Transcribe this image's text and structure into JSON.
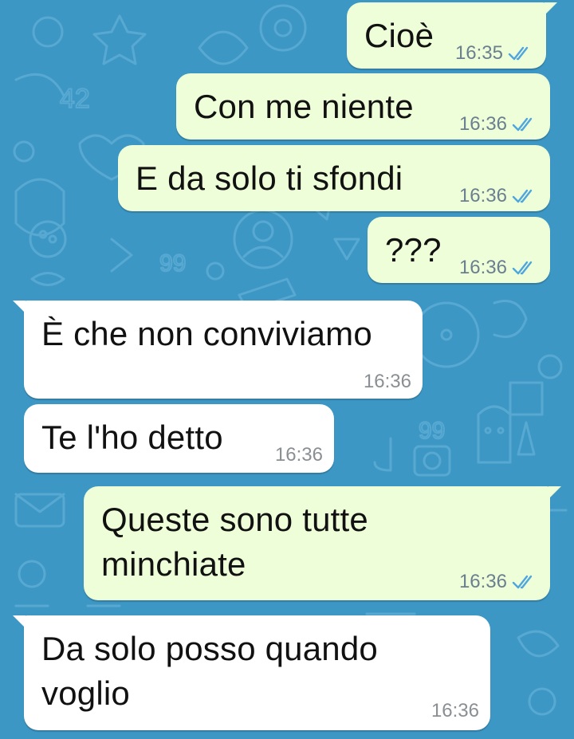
{
  "theme": {
    "wallpaper_color": "#3d97c4",
    "outgoing_bubble_color": "#eefed8",
    "incoming_bubble_color": "#ffffff",
    "tick_color": "#4fa6de"
  },
  "messages": [
    {
      "id": "m1",
      "direction": "outgoing",
      "text": "Cioè",
      "time": "16:35",
      "status_icon": "double-check-icon"
    },
    {
      "id": "m2",
      "direction": "outgoing",
      "text": "Con me niente",
      "time": "16:36",
      "status_icon": "double-check-icon"
    },
    {
      "id": "m3",
      "direction": "outgoing",
      "text": "E da solo ti sfondi",
      "time": "16:36",
      "status_icon": "double-check-icon"
    },
    {
      "id": "m4",
      "direction": "outgoing",
      "text": "???",
      "time": "16:36",
      "status_icon": "double-check-icon"
    },
    {
      "id": "m5",
      "direction": "incoming",
      "text": "È che non conviviamo",
      "time": "16:36"
    },
    {
      "id": "m6",
      "direction": "incoming",
      "text": "Te l'ho detto",
      "time": "16:36"
    },
    {
      "id": "m7",
      "direction": "outgoing",
      "text": "Queste sono tutte\nminchiate",
      "time": "16:36",
      "status_icon": "double-check-icon"
    },
    {
      "id": "m8",
      "direction": "incoming",
      "text": "Da solo posso quando\nvoglio",
      "time": "16:36"
    }
  ]
}
